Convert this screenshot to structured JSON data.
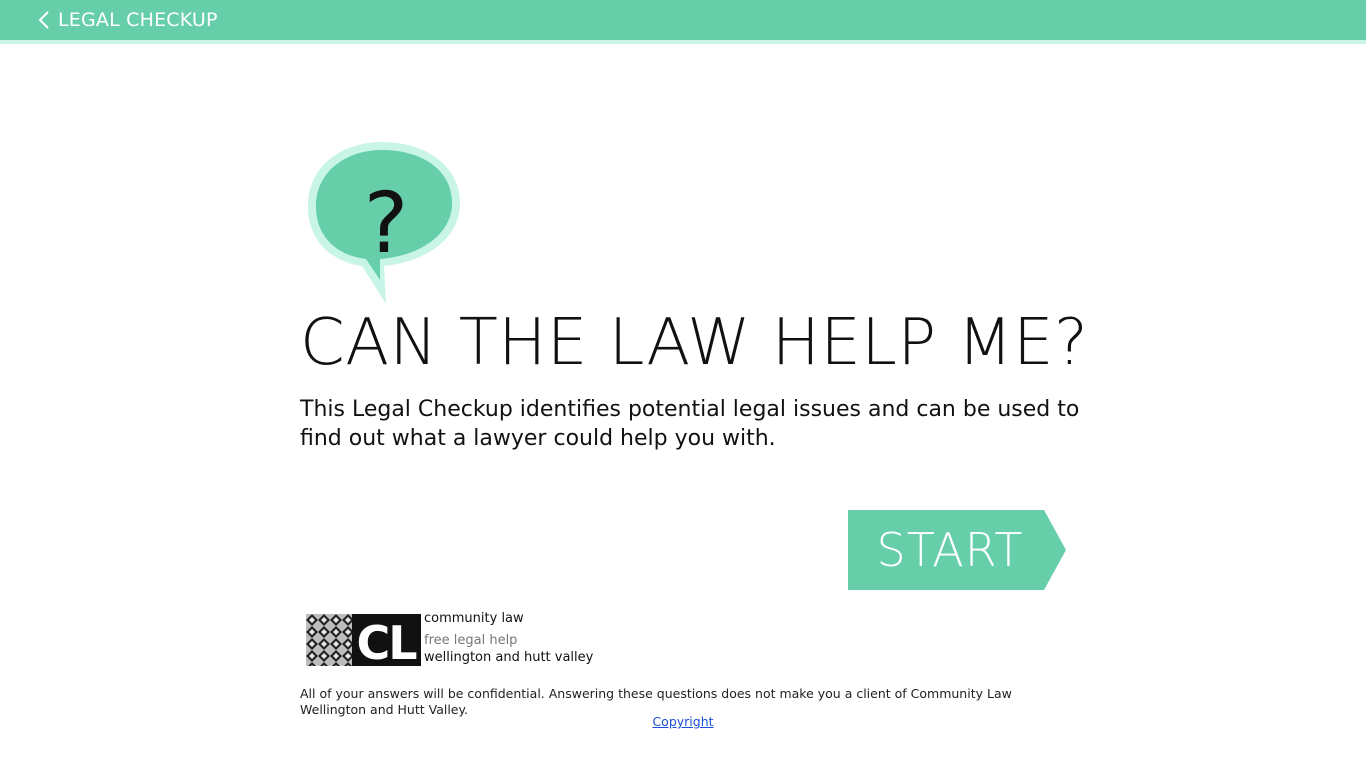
{
  "header": {
    "back_label": "LEGAL CHECKUP",
    "bar_color": "#66cfaa",
    "back_icon": "chevron-left-icon"
  },
  "hero": {
    "bubble_icon": "question-speech-bubble-icon",
    "bubble_glyph": "?",
    "title": "CAN THE LAW HELP ME?",
    "intro": "This Legal Checkup identifies potential legal issues and can be used to find out what a lawyer could help you with."
  },
  "actions": {
    "start_label": "START",
    "start_color": "#66cfaa"
  },
  "logo": {
    "mark": "CL",
    "line1": "community law",
    "line2": "free legal help",
    "line3": "wellington and hutt valley"
  },
  "footer": {
    "disclaimer": "All of your answers will be confidential. Answering these questions does not make you a client of Community Law Wellington and Hutt Valley.",
    "copyright_label": "Copyright"
  }
}
